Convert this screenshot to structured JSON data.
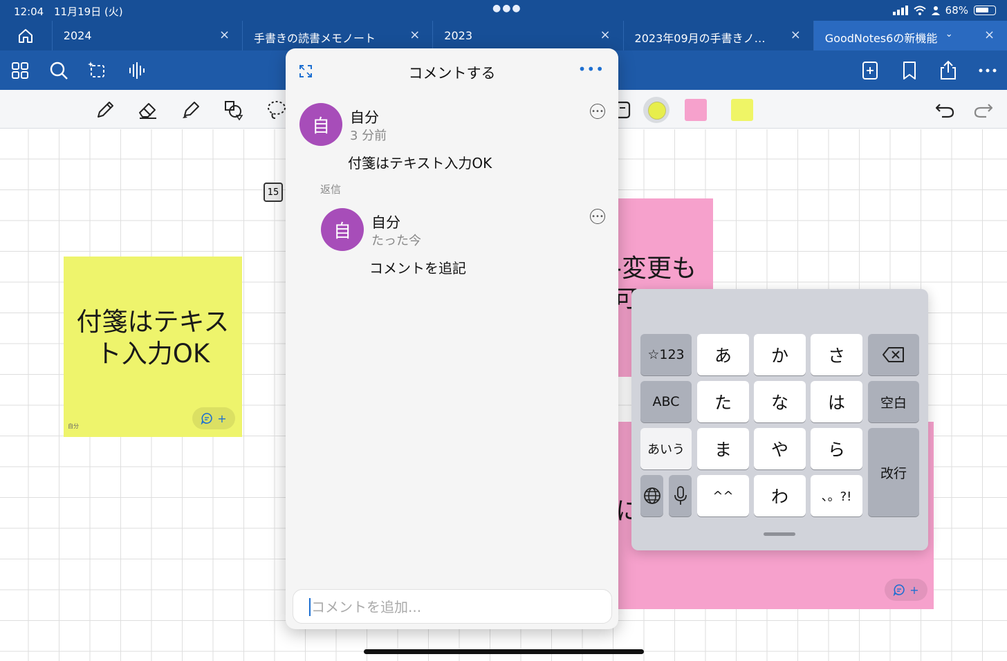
{
  "status_bar": {
    "time": "12:04",
    "date": "11月19日 (火)",
    "battery": "68%"
  },
  "tabs": [
    {
      "label": "2024"
    },
    {
      "label": "手書きの読書メモノート"
    },
    {
      "label": "2023"
    },
    {
      "label": "2023年09月の手書きノ…"
    },
    {
      "label": "GoodNotes6の新機能"
    }
  ],
  "canvas": {
    "yellow_note": {
      "line1": "付箋はテキス",
      "line2": "ト入力OK",
      "author": "自分"
    },
    "pink_note_1": {
      "line1": "-変更も",
      "line2": "可"
    },
    "pink_note_2": {
      "text": "に"
    },
    "badge": "15"
  },
  "comment_panel": {
    "title": "コメントする",
    "comments": [
      {
        "avatar": "自",
        "name": "自分",
        "time": "3 分前",
        "body": "付箋はテキスト入力OK"
      }
    ],
    "reply_label": "返信",
    "replies": [
      {
        "avatar": "自",
        "name": "自分",
        "time": "たった今",
        "body": "コメントを追記"
      }
    ],
    "input_placeholder": "コメントを追加..."
  },
  "keyboard": {
    "keys": {
      "num": "☆123",
      "a": "あ",
      "ka": "か",
      "sa": "さ",
      "abc": "ABC",
      "ta": "た",
      "na": "な",
      "ha": "は",
      "space": "空白",
      "aiu": "あいう",
      "ma": "ま",
      "ya": "や",
      "ra": "ら",
      "enter": "改行",
      "emo": "^^",
      "wa": "わ",
      "punct": "、。?!"
    }
  },
  "colors": {
    "accent": "#1e5aa8",
    "yellow_note": "#eef46c",
    "pink_note": "#f6a1cc",
    "avatar": "#a74db9"
  }
}
